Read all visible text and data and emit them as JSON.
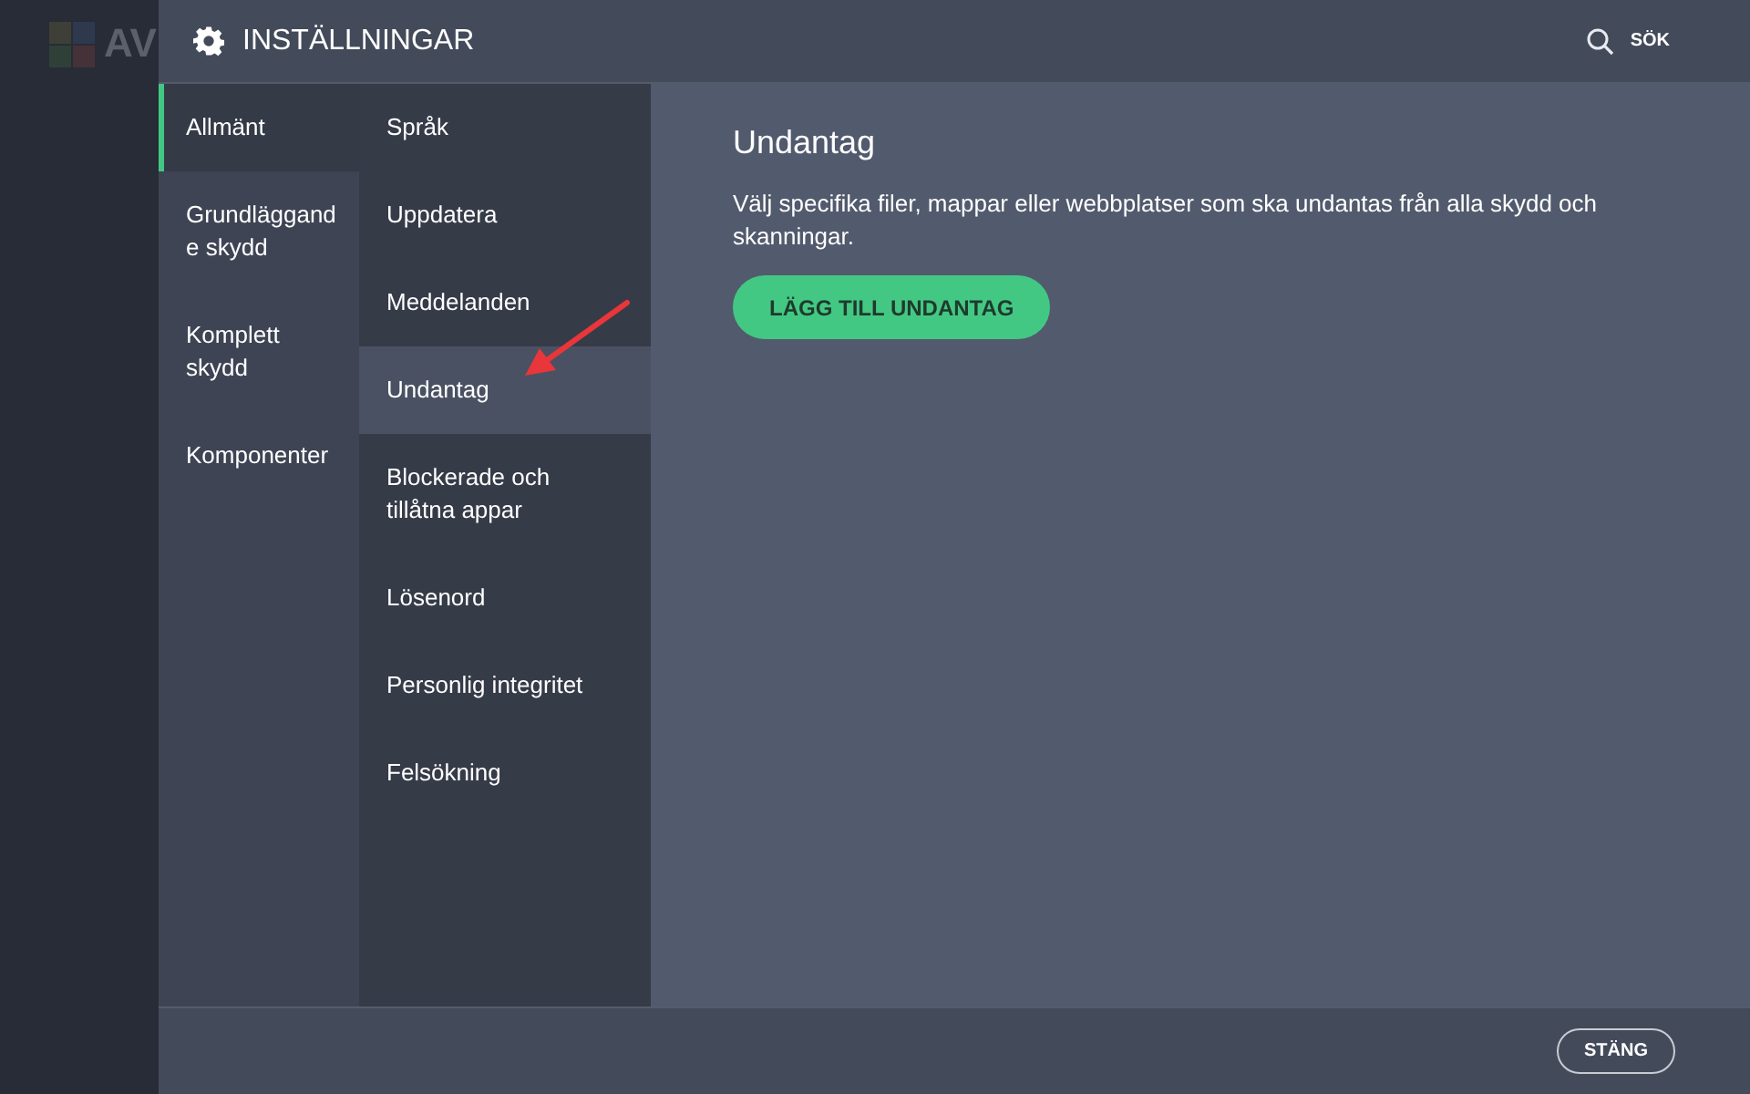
{
  "background_app": {
    "logo_text": "AV"
  },
  "window": {
    "title": "INSTÄLLNINGAR",
    "search_label": "SÖK"
  },
  "categories": [
    {
      "label": "Allmänt",
      "selected": true
    },
    {
      "label": "Grundläggande skydd",
      "selected": false
    },
    {
      "label": "Komplett skydd",
      "selected": false
    },
    {
      "label": "Komponenter",
      "selected": false
    }
  ],
  "subcategories": [
    {
      "label": "Språk",
      "selected": false
    },
    {
      "label": "Uppdatera",
      "selected": false
    },
    {
      "label": "Meddelanden",
      "selected": false
    },
    {
      "label": "Undantag",
      "selected": true
    },
    {
      "label": "Blockerade och tillåtna appar",
      "selected": false
    },
    {
      "label": "Lösenord",
      "selected": false
    },
    {
      "label": "Personlig integritet",
      "selected": false
    },
    {
      "label": "Felsökning",
      "selected": false
    }
  ],
  "content": {
    "heading": "Undantag",
    "description": "Välj specifika filer, mappar eller webbplatser som ska undantas från alla skydd och skanningar.",
    "add_button": "LÄGG TILL UNDANTAG"
  },
  "footer": {
    "close_button": "STÄNG"
  }
}
